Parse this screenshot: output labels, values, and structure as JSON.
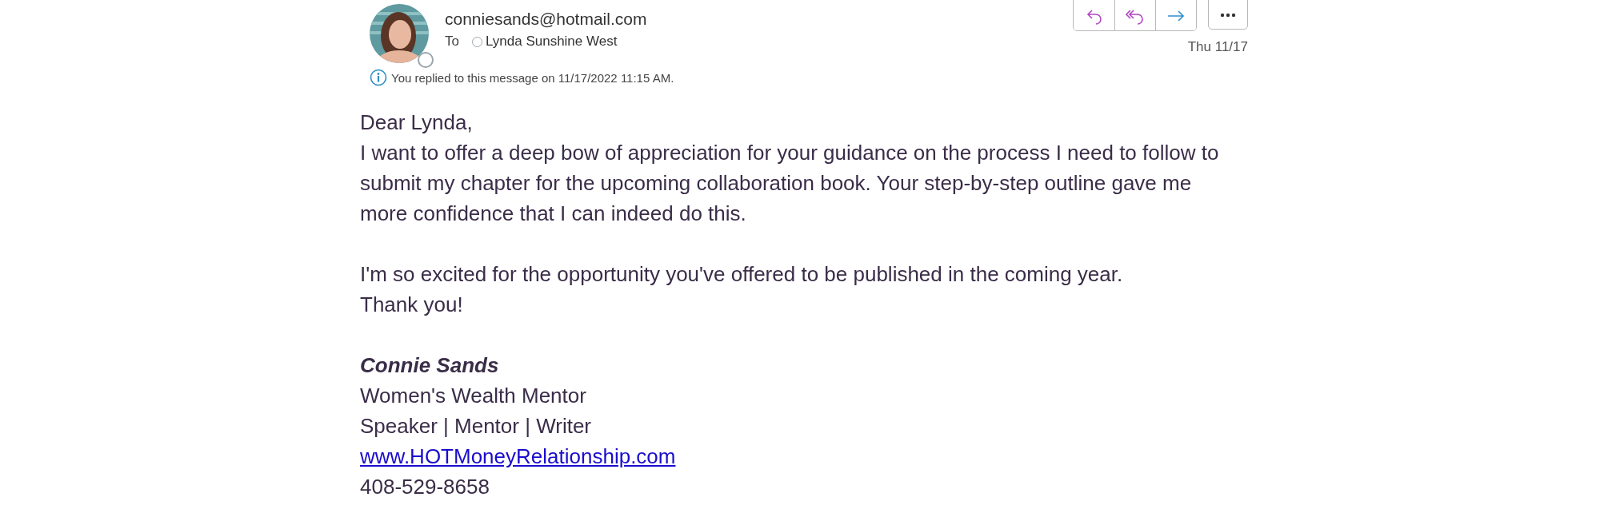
{
  "sender": {
    "email": "conniesands@hotmail.com",
    "to_label": "To",
    "recipient": "Lynda Sunshine West",
    "date": "Thu 11/17"
  },
  "actions": [
    {
      "kind": "reply"
    },
    {
      "kind": "reply-all"
    },
    {
      "kind": "forward"
    },
    {
      "kind": "more"
    }
  ],
  "info": "You replied to this message on 11/17/2022 11:15 AM.",
  "body": {
    "paragraphs": [
      [
        "Dear Lynda,",
        "I want to offer a deep bow of appreciation for your guidance on the process I need to follow to submit my chapter for the upcoming collaboration book. Your step-by-step outline gave me more confidence that I can indeed do this."
      ],
      [
        "I'm so excited for the opportunity you've offered to be published in the coming year.",
        "Thank you!"
      ]
    ]
  },
  "signature": [
    {
      "kind": "name",
      "text": "Connie Sands"
    },
    {
      "kind": "line",
      "text": "Women's Wealth Mentor"
    },
    {
      "kind": "line",
      "text": "Speaker | Mentor | Writer"
    },
    {
      "kind": "link",
      "text": "www.HOTMoneyRelationship.com"
    },
    {
      "kind": "line",
      "text": "408-529-8658"
    }
  ]
}
